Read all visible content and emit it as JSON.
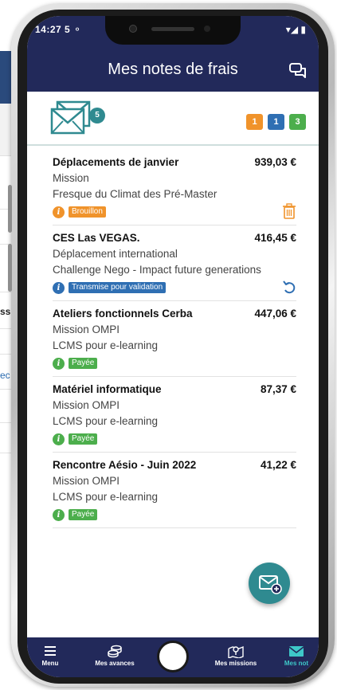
{
  "background_page": {
    "fragments": [
      "ssi",
      "ec"
    ]
  },
  "status_bar": {
    "time": "14:27",
    "left_icons": "5 ⚬",
    "right_icons": "▾◢ ▮"
  },
  "header": {
    "title": "Mes notes de frais",
    "chat_icon": "chat-bubbles-icon"
  },
  "summary": {
    "mail_icon": "envelope-stack-icon",
    "unread_count": "5",
    "counters": [
      {
        "value": "1",
        "color": "#f0932b"
      },
      {
        "value": "1",
        "color": "#2f6fb3"
      },
      {
        "value": "3",
        "color": "#4cae4c"
      }
    ]
  },
  "notes": [
    {
      "title": "Déplacements de janvier",
      "amount": "939,03 €",
      "type": "Mission",
      "mission": "Fresque du Climat des Pré-Master",
      "status": "Brouillon",
      "status_color": "#f0932b",
      "action_icon": "trash-icon"
    },
    {
      "title": "CES Las VEGAS.",
      "amount": "416,45 €",
      "type": "Déplacement international",
      "mission": "Challenge Nego - Impact future generations",
      "status": "Transmise pour validation",
      "status_color": "#2f6fb3",
      "action_icon": "undo-icon"
    },
    {
      "title": "Ateliers fonctionnels Cerba",
      "amount": "447,06 €",
      "type": "Mission OMPI",
      "mission": "LCMS pour e-learning",
      "status": "Payée",
      "status_color": "#4cae4c",
      "action_icon": ""
    },
    {
      "title": "Matériel informatique",
      "amount": "87,37 €",
      "type": "Mission OMPI",
      "mission": "LCMS pour e-learning",
      "status": "Payée",
      "status_color": "#4cae4c",
      "action_icon": ""
    },
    {
      "title": "Rencontre Aésio - Juin 2022",
      "amount": "41,22 €",
      "type": "Mission OMPI",
      "mission": "LCMS pour e-learning",
      "status": "Payée",
      "status_color": "#4cae4c",
      "action_icon": ""
    }
  ],
  "fab": {
    "icon": "new-mail-plus-icon"
  },
  "bottom_nav": {
    "items": [
      {
        "label": "Menu",
        "icon": "hamburger-icon"
      },
      {
        "label": "Mes avances",
        "icon": "coins-icon"
      },
      {
        "label": "Mes missions",
        "icon": "map-pin-icon"
      },
      {
        "label": "Mes not",
        "icon": "envelope-icon",
        "active": true
      }
    ]
  },
  "colors": {
    "header": "#22295a",
    "accent": "#2f8a90",
    "active_nav": "#3ec8c8"
  }
}
